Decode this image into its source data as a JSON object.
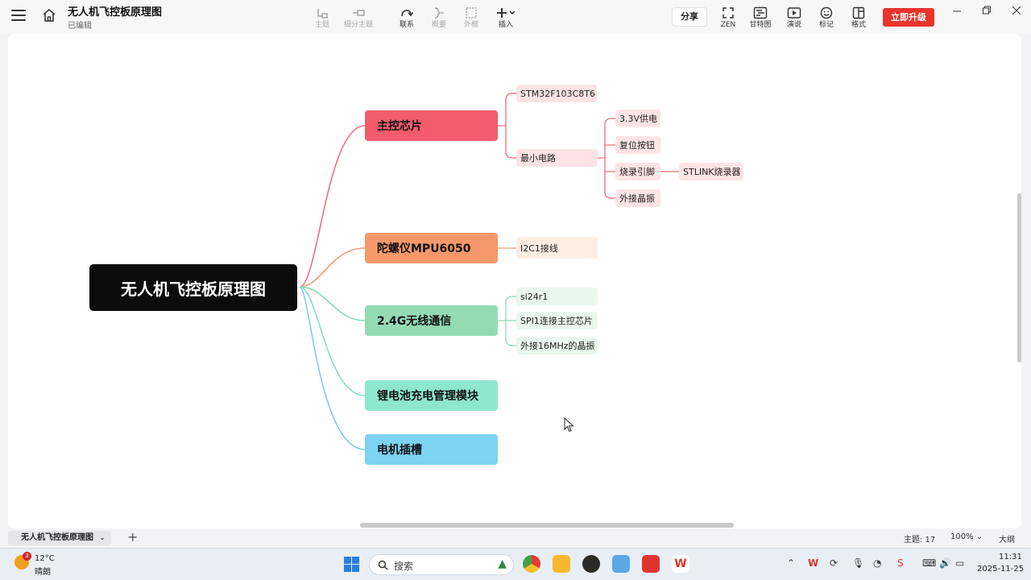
{
  "app": {
    "title": "无人机飞控板原理图",
    "status": "已编辑"
  },
  "toolbar": {
    "topic": "主题",
    "subtopic": "细分主题",
    "relation": "联系",
    "summary": "概要",
    "boundary": "外框",
    "insert": "插入",
    "share": "分享",
    "zen": "ZEN",
    "gantt": "甘特图",
    "present": "演说",
    "marker": "标记",
    "format": "格式",
    "upgrade": "立即升级"
  },
  "mindmap": {
    "root": "无人机飞控板原理图",
    "branches": [
      {
        "label": "主控芯片",
        "color": "#f25c6c",
        "children": [
          {
            "label": "STM32F103C8T6"
          },
          {
            "label": "最小电路",
            "children": [
              {
                "label": "3.3V供电"
              },
              {
                "label": "复位按钮"
              },
              {
                "label": "烧录引脚",
                "children": [
                  {
                    "label": "STLINK烧录器"
                  }
                ]
              },
              {
                "label": "外接晶振"
              }
            ]
          }
        ]
      },
      {
        "label": "陀螺仪MPU6050",
        "color": "#f5996a",
        "children": [
          {
            "label": "I2C1接线"
          }
        ]
      },
      {
        "label": "2.4G无线通信",
        "color": "#94dbb4",
        "children": [
          {
            "label": "si24r1"
          },
          {
            "label": "SPI1连接主控芯片"
          },
          {
            "label": "外接16MHz的晶振"
          }
        ]
      },
      {
        "label": "锂电池充电管理模块",
        "color": "#8ee6cf"
      },
      {
        "label": "电机插槽",
        "color": "#7dd3f2"
      }
    ]
  },
  "statusbar": {
    "sheet": "无人机飞控板原理图",
    "topic_count": "主题: 17",
    "zoom": "100%",
    "outline": "大纲"
  },
  "taskbar": {
    "temperature": "12°C",
    "condition": "晴朗",
    "badge": "3",
    "search": "搜索",
    "time": "11:31",
    "date": "2025-11-25"
  }
}
